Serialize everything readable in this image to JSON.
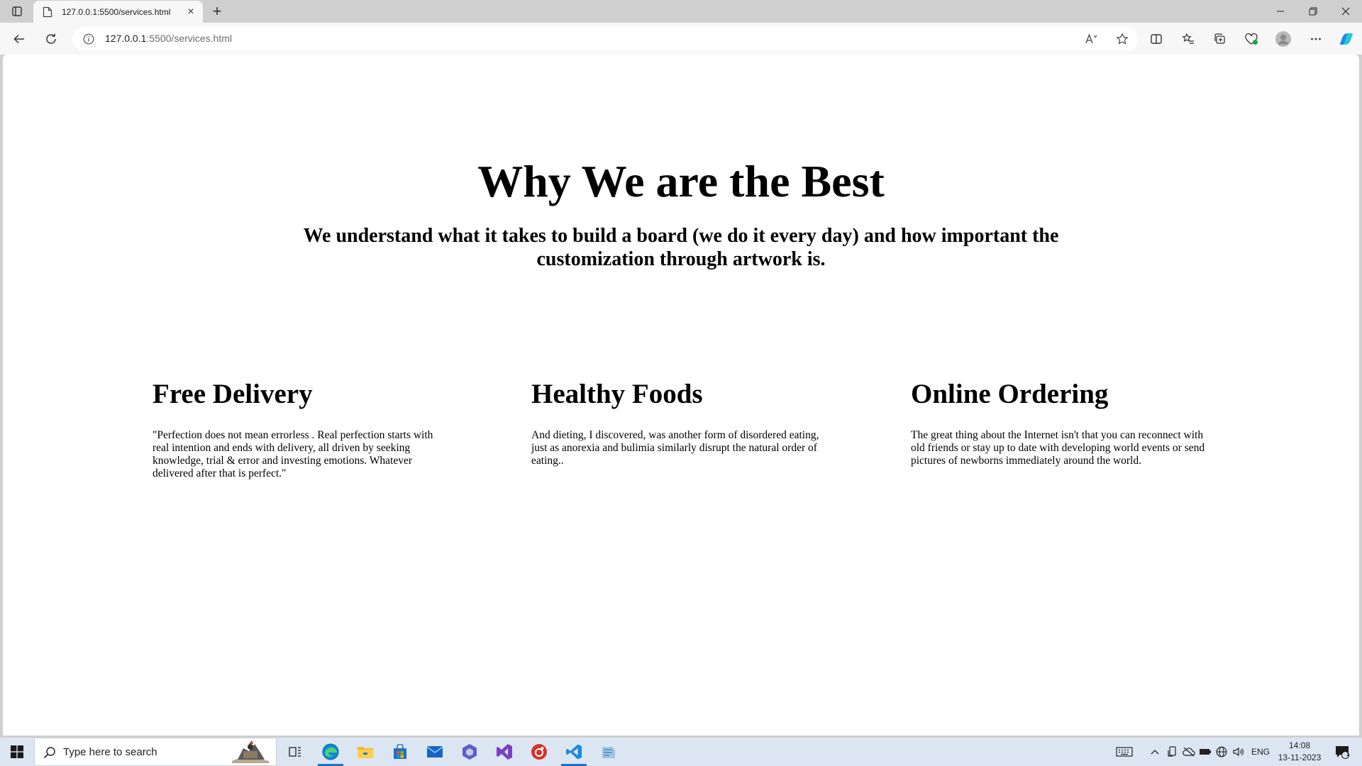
{
  "browser": {
    "tab": {
      "title": "127.0.0.1:5500/services.html",
      "close_icon": "×"
    },
    "new_tab_icon": "+",
    "url_host": "127.0.0.1",
    "url_rest": ":5500/services.html"
  },
  "page": {
    "title": "Why We are the Best",
    "subtitle": "We understand what it takes to build a board (we do it every day) and how important the customization through artwork is.",
    "features": [
      {
        "heading": "Free Delivery",
        "text": "\"Perfection does not mean errorless . Real perfection starts with real intention and ends with delivery, all driven by seeking knowledge, trial & error and investing emotions. Whatever delivered after that is perfect.\""
      },
      {
        "heading": "Healthy Foods",
        "text": "And dieting, I discovered, was another form of disordered eating, just as anorexia and bulimia similarly disrupt the natural order of eating.."
      },
      {
        "heading": "Online Ordering",
        "text": "The great thing about the Internet isn't that you can reconnect with old friends or stay up to date with developing world events or send pictures of newborns immediately around the world."
      }
    ]
  },
  "taskbar": {
    "search_placeholder": "Type here to search",
    "language": "ENG",
    "time": "14:08",
    "date": "13-11-2023",
    "notification_count": "1"
  },
  "colors": {
    "accent": "#1a73c9",
    "taskbar_bg": "#dce6f2",
    "chrome_bg": "#cfcfcf"
  }
}
